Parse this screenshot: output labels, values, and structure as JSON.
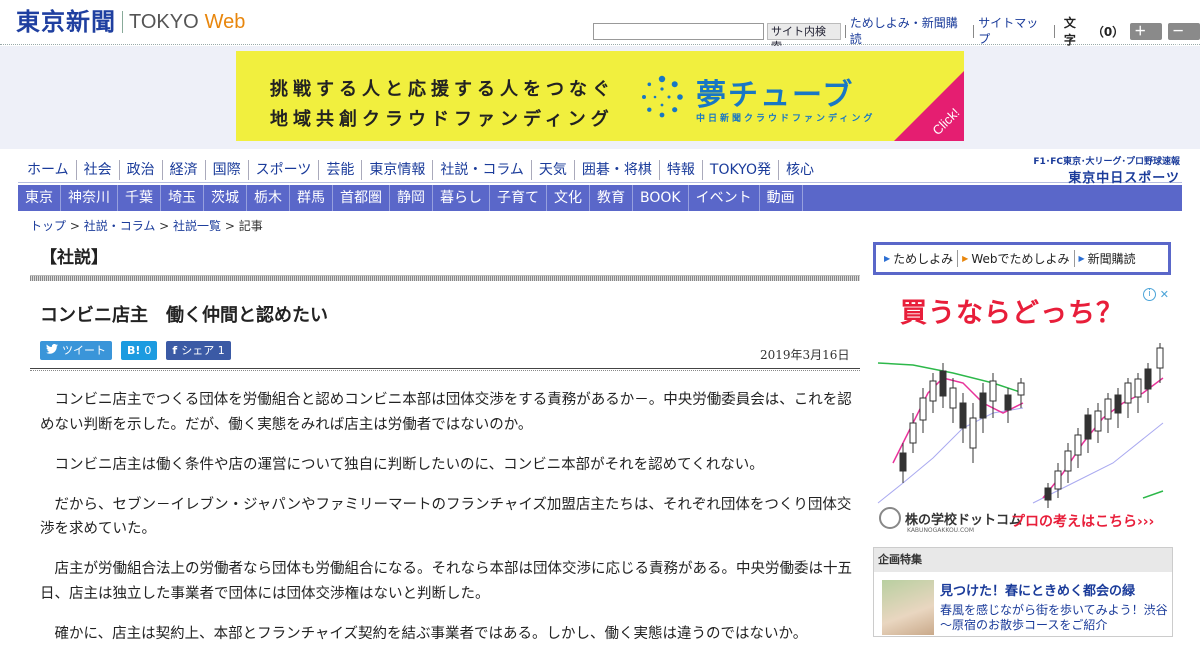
{
  "header": {
    "logo_jp": "東京新聞",
    "logo_en": "TOKYO",
    "logo_web": "Web",
    "search_button": "サイト内検索",
    "links": [
      "ためしよみ・新聞購読",
      "サイトマップ"
    ],
    "font_size_label": "文字",
    "font_size_value": "（0）",
    "larger_button": "＋大",
    "smaller_button": "－小"
  },
  "banner": {
    "line1": "挑戦する人と応援する人をつなぐ",
    "line2": "地域共創クラウドファンディング",
    "title": "夢チューブ",
    "subtitle": "中日新聞クラウドファンディング",
    "click": "Click!",
    "colors": {
      "background": "#f1ef3e",
      "brand": "#1877c4",
      "accent": "#e51e71"
    }
  },
  "nav": {
    "main": [
      "ホーム",
      "社会",
      "政治",
      "経済",
      "国際",
      "スポーツ",
      "芸能",
      "東京情報",
      "社説・コラム",
      "天気",
      "囲碁・将棋",
      "特報",
      "TOKYO発",
      "核心"
    ],
    "regional": [
      "東京",
      "神奈川",
      "千葉",
      "埼玉",
      "茨城",
      "栃木",
      "群馬",
      "首都圏",
      "静岡",
      "暮らし",
      "子育て",
      "文化",
      "教育",
      "BOOK",
      "イベント",
      "動画"
    ],
    "chunichi_top": "F1･FC東京･大リーグ･プロ野球速報",
    "chunichi_bottom": "東京中日スポーツ"
  },
  "breadcrumb": {
    "items": [
      "トップ",
      "社説・コラム",
      "社説一覧"
    ],
    "separator": " > ",
    "current": "記事"
  },
  "article": {
    "section": "【社説】",
    "title": "コンビニ店主　働く仲間と認めたい",
    "date": "2019年3月16日",
    "share": {
      "tweet": "ツイート",
      "hatena_icon": "B!",
      "hatena_count": "0",
      "facebook_icon": "f",
      "facebook_label": "シェア",
      "facebook_count": "1"
    },
    "paragraphs": [
      "コンビニ店主でつくる団体を労働組合と認めコンビニ本部は団体交渉をする責務があるか－。中央労働委員会は、これを認めない判断を示した。だが、働く実態をみれば店主は労働者ではないのか。",
      "コンビニ店主は働く条件や店の運営について独自に判断したいのに、コンビニ本部がそれを認めてくれない。",
      "だから、セブン－イレブン・ジャパンやファミリーマートのフランチャイズ加盟店主たちは、それぞれ団体をつくり団体交渉を求めていた。",
      "店主が労働組合法上の労働者なら団体も労働組合になる。それなら本部は団体交渉に応じる責務がある。中央労働委は十五日、店主は独立した事業者で団体には団体交渉権はないと判断した。",
      "確かに、店主は契約上、本部とフランチャイズ契約を結ぶ事業者ではある。しかし、働く実態は違うのではないか。"
    ]
  },
  "sidebar": {
    "subscribe": [
      "ためしよみ",
      "Webでためしよみ",
      "新聞購読"
    ],
    "ad": {
      "headline": "買うならどっち？",
      "logo_text": "株の学校ドットコム",
      "logo_url": "KABUNOGAKKOU.COM",
      "cta": "プロの考えはこちら",
      "icons": [
        "info-icon",
        "close-icon"
      ]
    },
    "feature": {
      "heading": "企画特集",
      "title": "見つけた！春にときめく都会の緑",
      "text": "春風を感じながら街を歩いてみよう！渋谷～原宿のお散歩コースをご紹介"
    }
  }
}
